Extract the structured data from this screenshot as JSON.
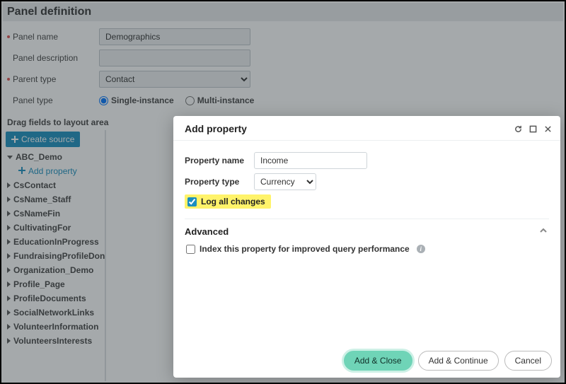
{
  "header": {
    "title": "Panel definition"
  },
  "form": {
    "panel_name": {
      "label": "Panel name",
      "value": "Demographics",
      "required": true
    },
    "panel_description": {
      "label": "Panel description",
      "value": "",
      "required": false
    },
    "parent_type": {
      "label": "Parent type",
      "value": "Contact",
      "required": true
    },
    "panel_type": {
      "label": "Panel type",
      "options": {
        "single": "Single-instance",
        "multi": "Multi-instance"
      },
      "selected": "single"
    }
  },
  "drag_heading": "Drag fields to layout area",
  "sidebar": {
    "create_source": "Create source",
    "add_property": "Add property",
    "items": [
      {
        "label": "ABC_Demo",
        "expanded": true
      },
      {
        "label": "CsContact"
      },
      {
        "label": "CsName_Staff"
      },
      {
        "label": "CsNameFin"
      },
      {
        "label": "CultivatingFor"
      },
      {
        "label": "EducationInProgress"
      },
      {
        "label": "FundraisingProfileDonorInfo"
      },
      {
        "label": "Organization_Demo"
      },
      {
        "label": "Profile_Page"
      },
      {
        "label": "ProfileDocuments"
      },
      {
        "label": "SocialNetworkLinks"
      },
      {
        "label": "VolunteerInformation"
      },
      {
        "label": "VolunteersInterests"
      }
    ]
  },
  "modal": {
    "title": "Add property",
    "property_name": {
      "label": "Property name",
      "value": "Income"
    },
    "property_type": {
      "label": "Property type",
      "value": "Currency"
    },
    "log_all_changes": {
      "label": "Log all changes",
      "checked": true
    },
    "advanced": {
      "label": "Advanced",
      "index_prop": {
        "label": "Index this property for improved query performance",
        "checked": false
      }
    },
    "buttons": {
      "add_close": "Add & Close",
      "add_continue": "Add & Continue",
      "cancel": "Cancel"
    }
  }
}
